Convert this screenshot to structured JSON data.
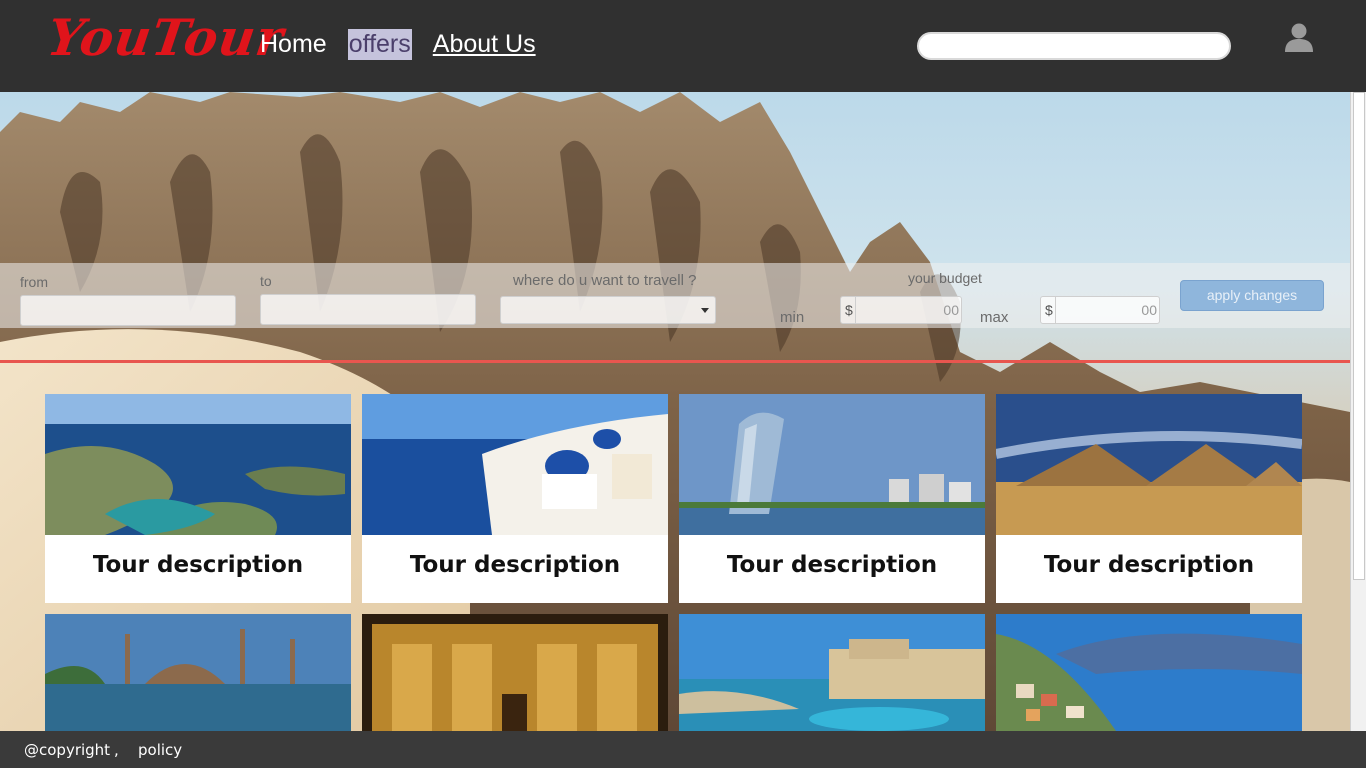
{
  "header": {
    "logo": "YouTour",
    "nav": [
      {
        "label": "Home"
      },
      {
        "label": "offers"
      },
      {
        "label": "About Us"
      }
    ],
    "search_value": "",
    "user_icon": "user-icon"
  },
  "filter": {
    "from_label": "from",
    "to_label": "to",
    "where_label": "where do u want to travell ?",
    "budget_label": "your budget",
    "min_label": "min",
    "max_label": "max",
    "currency": "$",
    "min_decimals": "00",
    "max_decimals": "00",
    "apply_label": "apply changes"
  },
  "tours": [
    {
      "desc": "Tour description"
    },
    {
      "desc": "Tour description"
    },
    {
      "desc": "Tour description"
    },
    {
      "desc": "Tour description"
    },
    {
      "desc": ""
    },
    {
      "desc": ""
    },
    {
      "desc": ""
    },
    {
      "desc": ""
    }
  ],
  "footer": {
    "copyright": "@copyright",
    "comma": ",",
    "policy": "policy"
  },
  "colors": {
    "header_bg": "#303030",
    "logo": "#e0141b",
    "nav_active_bg": "#c5c3dc",
    "divider": "#e8564f",
    "apply_bg": "#8fb6dc",
    "footer_bg": "#3a3a3a"
  }
}
